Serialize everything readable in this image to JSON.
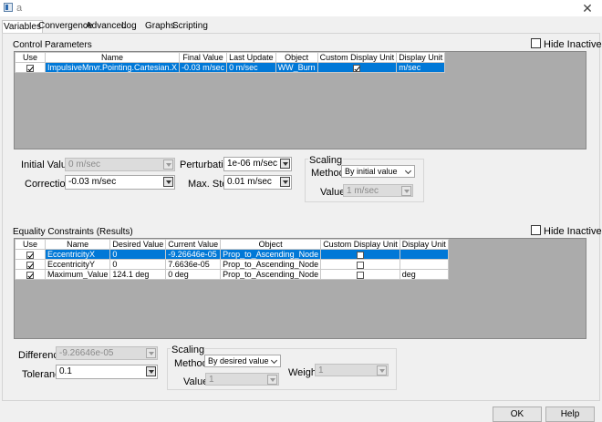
{
  "window": {
    "title": "a"
  },
  "tabs": [
    "Variables",
    "Convergence",
    "Advanced",
    "Log",
    "Graphs",
    "Scripting"
  ],
  "control": {
    "title": "Control Parameters",
    "hide_inactive": "Hide Inactive",
    "columns": [
      "Use",
      "Name",
      "Final Value",
      "Last Update",
      "Object",
      "Custom Display Unit",
      "Display Unit"
    ],
    "rows": [
      {
        "use": true,
        "name": "ImpulsiveMnvr.Pointing.Cartesian.X",
        "final_value": "-0.03 m/sec",
        "last_update": "0 m/sec",
        "object": "WW_Burn",
        "custom_display_unit": true,
        "display_unit": "m/sec"
      }
    ],
    "initial_value_label": "Initial Value:",
    "initial_value": "0 m/sec",
    "correction_label": "Correction:",
    "correction": "-0.03 m/sec",
    "perturbation_label": "Perturbation:",
    "perturbation": "1e-06 m/sec",
    "max_step_label": "Max. Step:",
    "max_step": "0.01 m/sec",
    "scaling_title": "Scaling",
    "method_label": "Method:",
    "method": "By initial value",
    "value_label": "Value:",
    "value": "1 m/sec"
  },
  "equality": {
    "title": "Equality Constraints (Results)",
    "hide_inactive": "Hide Inactive",
    "columns": [
      "Use",
      "Name",
      "Desired Value",
      "Current Value",
      "Object",
      "Custom Display Unit",
      "Display Unit"
    ],
    "rows": [
      {
        "use": true,
        "name": "EccentricityX",
        "desired_value": "0",
        "current_value": "-9.26646e-05",
        "object": "Prop_to_Ascending_Node",
        "custom_display_unit": false,
        "display_unit": ""
      },
      {
        "use": true,
        "name": "EccentricityY",
        "desired_value": "0",
        "current_value": "7.6636e-05",
        "object": "Prop_to_Ascending_Node",
        "custom_display_unit": false,
        "display_unit": ""
      },
      {
        "use": true,
        "name": "Maximum_Value",
        "desired_value": "124.1 deg",
        "current_value": "0 deg",
        "object": "Prop_to_Ascending_Node",
        "custom_display_unit": false,
        "display_unit": "deg"
      }
    ],
    "difference_label": "Difference:",
    "difference": "-9.26646e-05",
    "tolerance_label": "Tolerance:",
    "tolerance": "0.1",
    "scaling_title": "Scaling",
    "method_label": "Method:",
    "method": "By desired value",
    "value_label": "Value:",
    "value": "1",
    "weight_label": "Weight:",
    "weight": "1"
  },
  "buttons": {
    "ok": "OK",
    "help": "Help"
  }
}
